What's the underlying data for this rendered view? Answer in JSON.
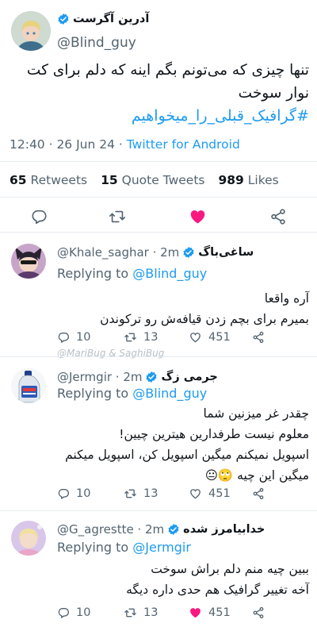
{
  "main_tweet": {
    "display_name": "آدرین آگرست",
    "handle": "@Blind_guy",
    "text": "تنها چیزی که می‌تونم بگم اینه که دلم برای کت نوار سوخت",
    "hashtag": "#گرافیک_قبلی_را_میخواهیم",
    "time": "12:40 · 26 Jun 24 ·",
    "client": "Twitter for Android",
    "stats": {
      "retweets_count": "65",
      "retweets_label": "Retweets",
      "quotes_count": "15",
      "quotes_label": "Quote Tweets",
      "likes_count": "989",
      "likes_label": "Likes"
    },
    "icons": [
      "reply-icon",
      "retweet-icon",
      "like-icon-filled",
      "share-icon"
    ]
  },
  "replies": [
    {
      "display_name": "ساغی‌باگ",
      "handle": "@Khale_saghar · 2m",
      "replying_prefix": "Replying to",
      "replying_to": "@Blind_guy",
      "text_lines": [
        "آره واقعا",
        "بمیرم برای بچم زدن قیافه‌ش رو ترکوندن"
      ],
      "replies": "10",
      "retweets": "13",
      "likes": "451"
    },
    {
      "display_name": "جرمی زگ",
      "handle": "@Jermgir · 2m",
      "replying_prefix": "Replying to",
      "replying_to": "@Blind_guy",
      "text_lines": [
        "چقدر غر میزنین شما",
        "معلوم نیست طرفدارین هیترین چیین!",
        "اسپویل نمیکنم میگین اسپویل کن، اسپویل میکنم",
        "میگین این چیه 🙄😐"
      ],
      "replies": "10",
      "retweets": "13",
      "likes": "451"
    },
    {
      "display_name": "خدابیامرز شده",
      "handle": "@G_agrestte · 2m",
      "replying_prefix": "Replying to",
      "replying_to": "@Jermgir",
      "text_lines": [
        "ببین چیه منم دلم براش سوخت",
        "آخه تغییر گرافیک هم حدی داره دیگه"
      ],
      "replies": "10",
      "retweets": "13",
      "likes": "451"
    }
  ],
  "watermark": "@MariBug & SaghiBug",
  "colors": {
    "accent": "#1d9bf0",
    "like": "#f91880",
    "secondary_text": "#536471",
    "divider": "#e6ecf0"
  }
}
